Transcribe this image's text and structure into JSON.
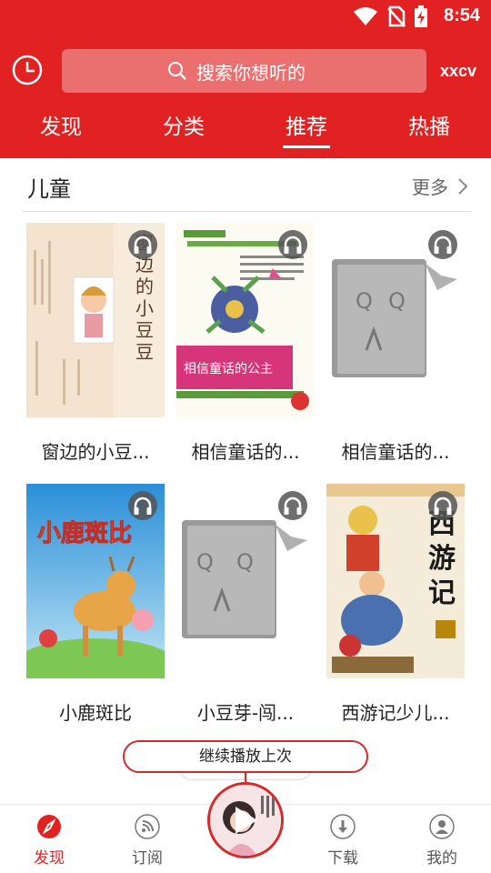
{
  "status_bar": {
    "time": "8:54"
  },
  "header": {
    "search_placeholder": "搜索你想听的",
    "user_name": "xxcv",
    "tabs": [
      {
        "label": "发现"
      },
      {
        "label": "分类"
      },
      {
        "label": "推荐",
        "active": true
      },
      {
        "label": "热播"
      }
    ]
  },
  "section": {
    "title": "儿童",
    "more_label": "更多",
    "books": [
      {
        "title": "窗边的小豆...",
        "cover_text": "窗边的小豆豆"
      },
      {
        "title": "相信童话的...",
        "cover_text": "相信童话的公主"
      },
      {
        "title": "相信童话的...",
        "cover_text": ""
      },
      {
        "title": "小鹿斑比",
        "cover_text": "小鹿斑比"
      },
      {
        "title": "小豆芽-闯...",
        "cover_text": ""
      },
      {
        "title": "西游记少儿...",
        "cover_text": "西游记"
      }
    ]
  },
  "player": {
    "continue_label": "继续播放上次"
  },
  "bottom_nav": {
    "items": [
      {
        "label": "发现",
        "icon": "compass-icon",
        "active": true
      },
      {
        "label": "订阅",
        "icon": "rss-icon"
      },
      {
        "label": "下载",
        "icon": "download-icon"
      },
      {
        "label": "我的",
        "icon": "user-icon"
      }
    ]
  },
  "colors": {
    "brand_red": "#e22222"
  }
}
